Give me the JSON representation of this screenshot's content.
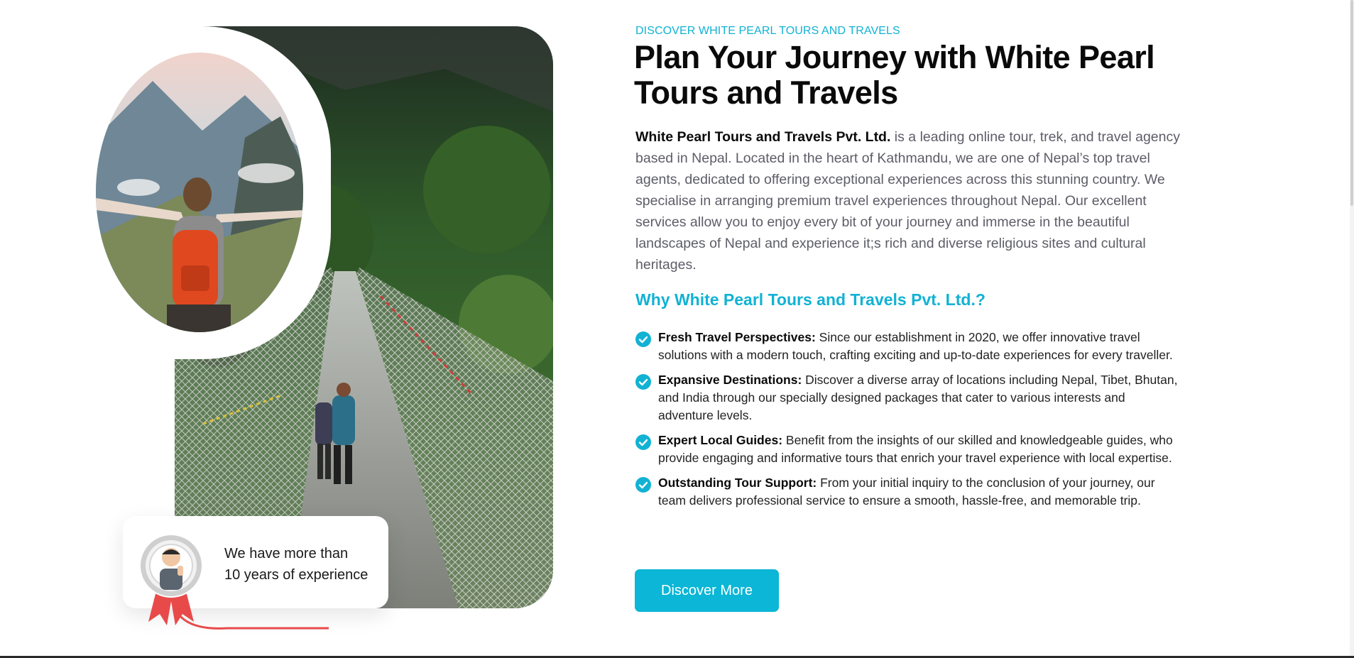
{
  "hero_visual": {
    "experience_card": {
      "line1": "We have more than",
      "line2": "10 years of experience"
    },
    "accent_color": "#e84a4a",
    "badge_icon": "award-ribbon-mascot-icon"
  },
  "about": {
    "eyebrow": "DISCOVER WHITE PEARL TOURS AND TRAVELS",
    "title": "Plan Your Journey with White Pearl Tours and Travels",
    "intro_bold": "White Pearl Tours and Travels Pvt. Ltd.",
    "intro_rest": " is a leading online tour, trek, and travel agency based in Nepal. Located in the heart of Kathmandu, we are one of Nepal’s top travel agents, dedicated to offering exceptional experiences across this stunning country. We specialise in arranging premium travel experiences throughout Nepal. Our excellent services allow you to enjoy every bit of your journey and immerse in the beautiful landscapes of Nepal and experience it;s rich and diverse religious sites and cultural heritages.",
    "why_title": "Why White Pearl Tours and Travels Pvt. Ltd.?",
    "features": [
      {
        "label": "Fresh Travel Perspectives:",
        "text": " Since our establishment in 2020, we offer innovative travel solutions with a modern touch, crafting exciting and up-to-date experiences for every traveller."
      },
      {
        "label": "Expansive Destinations:",
        "text": " Discover a diverse array of locations including Nepal, Tibet, Bhutan, and India through our specially designed packages that cater to various interests and adventure levels."
      },
      {
        "label": "Expert Local Guides:",
        "text": " Benefit from the insights of our skilled and knowledgeable guides, who provide engaging and informative tours that enrich your travel experience with local expertise."
      },
      {
        "label": "Outstanding Tour Support:",
        "text": " From your initial inquiry to the conclusion of your journey, our team delivers professional service to ensure a smooth, hassle-free, and memorable trip."
      }
    ],
    "cta_label": "Discover More",
    "accent_color": "#11b2d4"
  }
}
